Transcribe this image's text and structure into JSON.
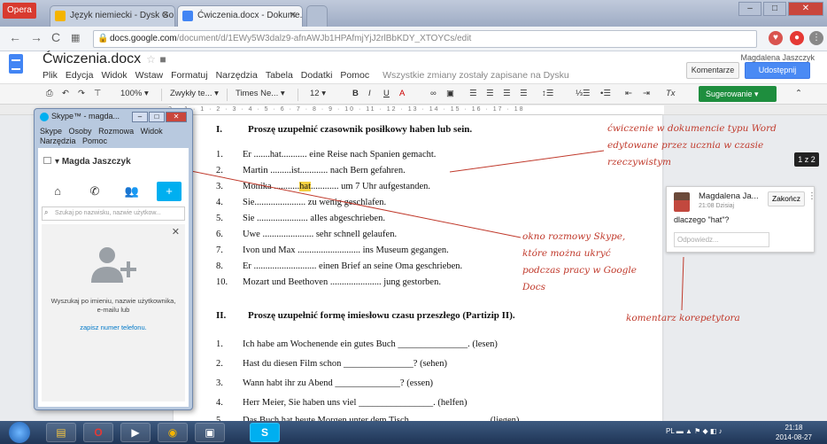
{
  "browser": {
    "opera_label": "Opera",
    "tabs": [
      {
        "label": "Język niemiecki - Dysk Go...",
        "icon": "google-drive-icon",
        "active": false
      },
      {
        "label": "Ćwiczenia.docx - Dokume...",
        "icon": "google-docs-icon",
        "active": true
      }
    ],
    "url_host": "docs.google.com",
    "url_path": "/document/d/1EWy5W3dalz9-afnAWJb1HPAfmjYjJ2rlBbKDY_XTOYCs/edit"
  },
  "docs": {
    "title": "Ćwiczenia.docx",
    "menu": [
      "Plik",
      "Edycja",
      "Widok",
      "Wstaw",
      "Formatuj",
      "Narzędzia",
      "Tabela",
      "Dodatki",
      "Pomoc"
    ],
    "saved_status": "Wszystkie zmiany zostały zapisane na Dysku",
    "user_name": "Magdalena Jaszczyk",
    "comments_button": "Komentarze",
    "share_button": "Udostępnij",
    "toolbar": {
      "zoom": "100%",
      "style": "Zwykły te...",
      "font": "Times Ne...",
      "size": "12",
      "suggest_button": "Sugerowanie"
    },
    "ruler_text": "2 · 1 · 1 · 2 · 3 · 4 · 5 · 6 · 7 · 8 · 9 · 10 · 11 · 12 · 13 · 14 · 15 · 16 · 17 · 18",
    "page_counter": "1 z 2"
  },
  "document": {
    "section1": {
      "numeral": "I.",
      "heading": "Proszę uzupełnić czasownik posiłkowy haben lub sein.",
      "items": [
        {
          "num": "1.",
          "pre": "Er .......",
          "fill": "hat",
          "post": "........... eine Reise nach Spanien gemacht."
        },
        {
          "num": "2.",
          "pre": "Martin .........",
          "fill": "ist",
          "post": "............ nach Bern gefahren."
        },
        {
          "num": "3.",
          "pre": "Monika ...........",
          "fill": "hat",
          "post": "............ um 7 Uhr aufgestanden."
        },
        {
          "num": "4.",
          "pre": "Sie......................",
          "fill": "",
          "post": " zu wenig geschlafen."
        },
        {
          "num": "5.",
          "pre": "Sie ......................",
          "fill": "",
          "post": " alles abgeschrieben."
        },
        {
          "num": "6.",
          "pre": "Uwe ......................",
          "fill": "",
          "post": " sehr schnell gelaufen."
        },
        {
          "num": "7.",
          "pre": "Ivon und Max ...........................",
          "fill": "",
          "post": " ins Museum gegangen."
        },
        {
          "num": "8.",
          "pre": "Er ...........................",
          "fill": "",
          "post": " einen Brief an seine Oma geschrieben."
        },
        {
          "num": "10.",
          "pre": "Mozart und Beethoven ......................",
          "fill": "",
          "post": " jung gestorben."
        }
      ]
    },
    "section2": {
      "numeral": "II.",
      "heading": "Proszę uzupełnić formę imiesłowu czasu przeszłego (Partizip II).",
      "items": [
        {
          "num": "1.",
          "text": "Ich habe am Wochenende ein gutes Buch _______________. (lesen)"
        },
        {
          "num": "2.",
          "text": "Hast du diesen Film schon _______________? (sehen)"
        },
        {
          "num": "3.",
          "text": "Wann habt ihr zu Abend ______________? (essen)"
        },
        {
          "num": "4.",
          "text": "Herr Meier, Sie haben uns viel ________________. (helfen)"
        },
        {
          "num": "5.",
          "text": "Das Buch hat heute Morgen unter dem Tisch ________________. (liegen)"
        }
      ]
    }
  },
  "comment": {
    "author": "Magdalena Ja...",
    "time": "21:08 Dzisiaj",
    "resolve_button": "Zakończ",
    "text": "dlaczego \"hat\"?",
    "reply_placeholder": "Odpowiedz..."
  },
  "annotations": {
    "word_note": [
      "ćwiczenie w dokumencie typu Word",
      "edytowane przez ucznia w czasie",
      "rzeczywistym"
    ],
    "skype_note": [
      "okno rozmowy Skype,",
      "które można ukryć",
      "podczas pracy w Google",
      "Docs"
    ],
    "comment_note": "komentarz korepetytora",
    "color": "#c0392b"
  },
  "skype": {
    "title": "Skype™ - magda...",
    "menu": [
      "Skype",
      "Osoby",
      "Rozmowa",
      "Widok",
      "Narzędzia",
      "Pomoc"
    ],
    "user": "Magda Jaszczyk",
    "search_placeholder": "Szukaj po nazwisku, nazwie użytkow...",
    "panel_text": "Wyszukaj po imieniu, nazwie użytkownika, e-mailu lub",
    "panel_link": "zapisz numer telefonu."
  },
  "taskbar": {
    "apps": [
      "explorer-icon",
      "opera-icon",
      "media-player-icon",
      "chrome-icon",
      "window-icon",
      "skype-icon"
    ],
    "language": "PL",
    "time": "21:18",
    "date": "2014-08-27"
  }
}
